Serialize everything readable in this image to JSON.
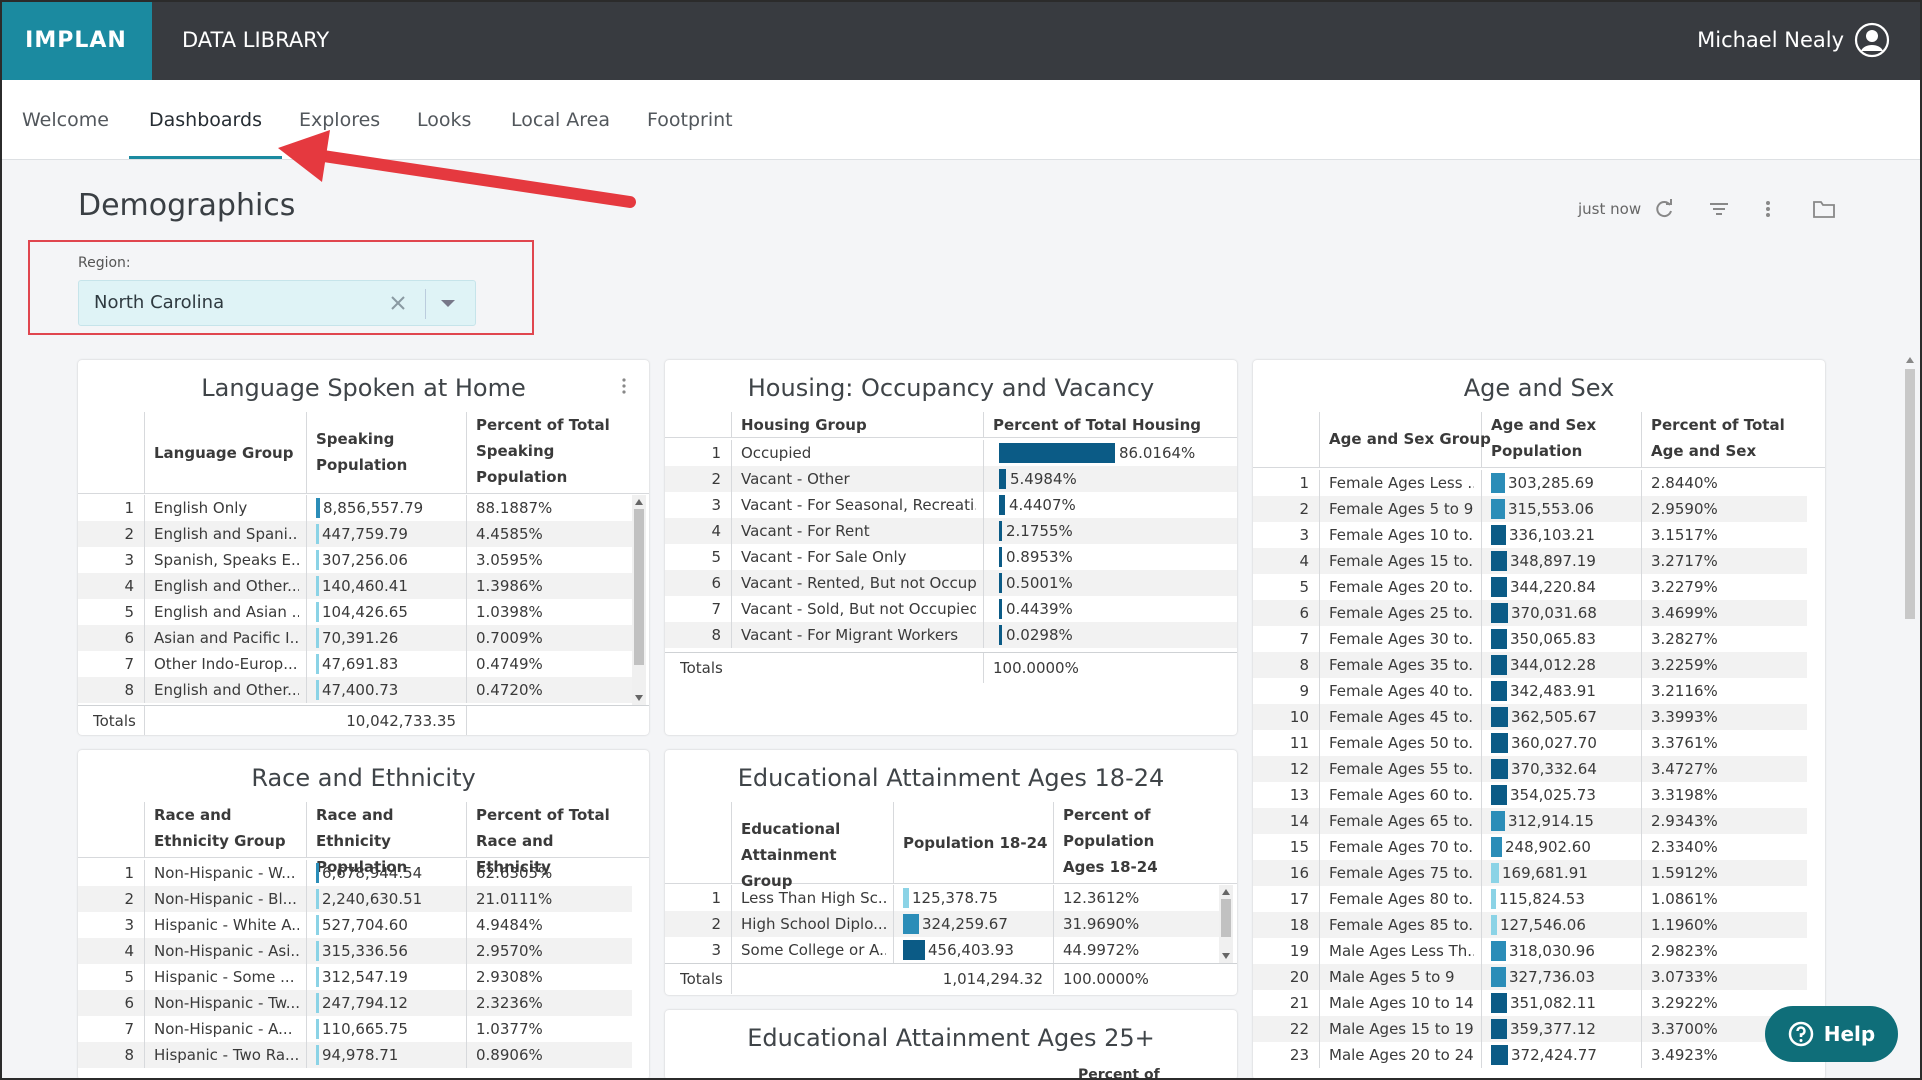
{
  "topbar": {
    "logo": "IMPLAN",
    "app_title": "DATA LIBRARY",
    "user_name": "Michael Nealy"
  },
  "nav": {
    "tabs": [
      "Welcome",
      "Dashboards",
      "Explores",
      "Looks",
      "Local Area",
      "Footprint"
    ],
    "active": "Dashboards"
  },
  "dashboard": {
    "title": "Demographics",
    "last_updated": "just now",
    "filter": {
      "label": "Region:",
      "value": "North Carolina"
    }
  },
  "colors": {
    "accent": "#1b8aa0",
    "bar_dark": "#0b5b86",
    "bar_mid": "#2b8db8",
    "bar_light": "#8bd3e6",
    "highlight": "#e0464f",
    "help": "#0f6e79"
  },
  "language": {
    "title": "Language Spoken at Home",
    "columns": [
      "Language Group",
      "Speaking Population",
      "Percent of Total Speaking Population"
    ],
    "rows": [
      {
        "n": "1",
        "group": "English Only",
        "pop": "8,856,557.79",
        "pct": "88.1887%",
        "share": 0.8819
      },
      {
        "n": "2",
        "group": "English and Spani...",
        "pop": "447,759.79",
        "pct": "4.4585%",
        "share": 0.0446
      },
      {
        "n": "3",
        "group": "Spanish, Speaks E...",
        "pop": "307,256.06",
        "pct": "3.0595%",
        "share": 0.0306
      },
      {
        "n": "4",
        "group": "English and Other...",
        "pop": "140,460.41",
        "pct": "1.3986%",
        "share": 0.014
      },
      {
        "n": "5",
        "group": "English and Asian ...",
        "pop": "104,426.65",
        "pct": "1.0398%",
        "share": 0.0104
      },
      {
        "n": "6",
        "group": "Asian and Pacific I...",
        "pop": "70,391.26",
        "pct": "0.7009%",
        "share": 0.007
      },
      {
        "n": "7",
        "group": "Other Indo-Europ...",
        "pop": "47,691.83",
        "pct": "0.4749%",
        "share": 0.0047
      },
      {
        "n": "8",
        "group": "English and Other...",
        "pop": "47,400.73",
        "pct": "0.4720%",
        "share": 0.0047
      }
    ],
    "totals": {
      "label": "Totals",
      "pop": "10,042,733.35"
    }
  },
  "housing": {
    "title": "Housing: Occupancy and Vacancy",
    "columns": [
      "Housing Group",
      "Percent of Total Housing"
    ],
    "rows": [
      {
        "n": "1",
        "group": "Occupied",
        "pct": "86.0164%",
        "share": 0.8602
      },
      {
        "n": "2",
        "group": "Vacant - Other",
        "pct": "5.4984%",
        "share": 0.055
      },
      {
        "n": "3",
        "group": "Vacant - For Seasonal, Recreati...",
        "pct": "4.4407%",
        "share": 0.0444
      },
      {
        "n": "4",
        "group": "Vacant - For Rent",
        "pct": "2.1755%",
        "share": 0.0218
      },
      {
        "n": "5",
        "group": "Vacant - For Sale Only",
        "pct": "0.8953%",
        "share": 0.009
      },
      {
        "n": "6",
        "group": "Vacant - Rented, But not Occup...",
        "pct": "0.5001%",
        "share": 0.005
      },
      {
        "n": "7",
        "group": "Vacant - Sold, But not Occupied",
        "pct": "0.4439%",
        "share": 0.0044
      },
      {
        "n": "8",
        "group": "Vacant - For Migrant Workers",
        "pct": "0.0298%",
        "share": 0.0003
      }
    ],
    "totals": {
      "label": "Totals",
      "pct": "100.0000%"
    }
  },
  "agesex": {
    "title": "Age and Sex",
    "columns": [
      "Age and Sex Group",
      "Age and Sex Population",
      "Percent of Total Age and Sex"
    ],
    "rows": [
      {
        "n": "1",
        "group": "Female Ages Less ...",
        "pop": "303,285.69",
        "pct": "2.8440%",
        "share": 0.8191
      },
      {
        "n": "2",
        "group": "Female Ages 5 to 9",
        "pop": "315,553.06",
        "pct": "2.9590%",
        "share": 0.8522
      },
      {
        "n": "3",
        "group": "Female Ages 10 to...",
        "pop": "336,103.21",
        "pct": "3.1517%",
        "share": 0.9077
      },
      {
        "n": "4",
        "group": "Female Ages 15 to...",
        "pop": "348,897.19",
        "pct": "3.2717%",
        "share": 0.9422
      },
      {
        "n": "5",
        "group": "Female Ages 20 to...",
        "pop": "344,220.84",
        "pct": "3.2279%",
        "share": 0.9296
      },
      {
        "n": "6",
        "group": "Female Ages 25 to...",
        "pop": "370,031.68",
        "pct": "3.4699%",
        "share": 0.9993
      },
      {
        "n": "7",
        "group": "Female Ages 30 to...",
        "pop": "350,065.83",
        "pct": "3.2827%",
        "share": 0.9454
      },
      {
        "n": "8",
        "group": "Female Ages 35 to...",
        "pop": "344,012.28",
        "pct": "3.2259%",
        "share": 0.9291
      },
      {
        "n": "9",
        "group": "Female Ages 40 to...",
        "pop": "342,483.91",
        "pct": "3.2116%",
        "share": 0.9249
      },
      {
        "n": "10",
        "group": "Female Ages 45 to...",
        "pop": "362,505.67",
        "pct": "3.3993%",
        "share": 0.979
      },
      {
        "n": "11",
        "group": "Female Ages 50 to...",
        "pop": "360,027.70",
        "pct": "3.3761%",
        "share": 0.9723
      },
      {
        "n": "12",
        "group": "Female Ages 55 to...",
        "pop": "370,332.64",
        "pct": "3.4727%",
        "share": 1.0
      },
      {
        "n": "13",
        "group": "Female Ages 60 to...",
        "pop": "354,025.73",
        "pct": "3.3198%",
        "share": 0.956
      },
      {
        "n": "14",
        "group": "Female Ages 65 to...",
        "pop": "312,914.15",
        "pct": "2.9343%",
        "share": 0.845
      },
      {
        "n": "15",
        "group": "Female Ages 70 to...",
        "pop": "248,902.60",
        "pct": "2.3340%",
        "share": 0.6721
      },
      {
        "n": "16",
        "group": "Female Ages 75 to...",
        "pop": "169,681.91",
        "pct": "1.5912%",
        "share": 0.4582
      },
      {
        "n": "17",
        "group": "Female Ages 80 to...",
        "pop": "115,824.53",
        "pct": "1.0861%",
        "share": 0.3128
      },
      {
        "n": "18",
        "group": "Female Ages 85 to...",
        "pop": "127,546.06",
        "pct": "1.1960%",
        "share": 0.3444
      },
      {
        "n": "19",
        "group": "Male Ages Less Th...",
        "pop": "318,030.96",
        "pct": "2.9823%",
        "share": 0.8588
      },
      {
        "n": "20",
        "group": "Male Ages 5 to 9",
        "pop": "327,736.03",
        "pct": "3.0733%",
        "share": 0.885
      },
      {
        "n": "21",
        "group": "Male Ages 10 to 14",
        "pop": "351,082.11",
        "pct": "3.2922%",
        "share": 0.948
      },
      {
        "n": "22",
        "group": "Male Ages 15 to 19",
        "pop": "359,377.12",
        "pct": "3.3700%",
        "share": 0.9704
      },
      {
        "n": "23",
        "group": "Male Ages 20 to 24",
        "pop": "372,424.77",
        "pct": "3.4923%",
        "share": 1.0
      }
    ]
  },
  "race": {
    "title": "Race and Ethnicity",
    "columns": [
      "Race and Ethnicity Group",
      "Race and Ethnicity Population",
      "Percent of Total Race and Ethnicity"
    ],
    "rows": [
      {
        "n": "1",
        "group": "Non-Hispanic - W...",
        "pop": "6,678,944.54",
        "pct": "62.6305%",
        "share": 0.6263
      },
      {
        "n": "2",
        "group": "Non-Hispanic - Bl...",
        "pop": "2,240,630.51",
        "pct": "21.0111%",
        "share": 0.2101
      },
      {
        "n": "3",
        "group": "Hispanic - White A...",
        "pop": "527,704.60",
        "pct": "4.9484%",
        "share": 0.0495
      },
      {
        "n": "4",
        "group": "Non-Hispanic - Asi...",
        "pop": "315,336.56",
        "pct": "2.9570%",
        "share": 0.0296
      },
      {
        "n": "5",
        "group": "Hispanic - Some ...",
        "pop": "312,547.19",
        "pct": "2.9308%",
        "share": 0.0293
      },
      {
        "n": "6",
        "group": "Non-Hispanic - Tw...",
        "pop": "247,794.12",
        "pct": "2.3236%",
        "share": 0.0232
      },
      {
        "n": "7",
        "group": "Non-Hispanic - A...",
        "pop": "110,665.75",
        "pct": "1.0377%",
        "share": 0.0104
      },
      {
        "n": "8",
        "group": "Hispanic - Two Ra...",
        "pop": "94,978.71",
        "pct": "0.8906%",
        "share": 0.0089
      }
    ]
  },
  "edu1824": {
    "title": "Educational Attainment Ages 18-24",
    "columns": [
      "Educational Attainment Group",
      "Population 18-24",
      "Percent of Population Ages 18-24"
    ],
    "rows": [
      {
        "n": "1",
        "group": "Less Than High Sc...",
        "pop": "125,378.75",
        "pct": "12.3612%",
        "share": 0.2747
      },
      {
        "n": "2",
        "group": "High School Diplo...",
        "pop": "324,259.67",
        "pct": "31.9690%",
        "share": 0.7104
      },
      {
        "n": "3",
        "group": "Some College or A...",
        "pop": "456,403.93",
        "pct": "44.9972%",
        "share": 1.0
      }
    ],
    "totals": {
      "label": "Totals",
      "pop": "1,014,294.32",
      "pct": "100.0000%"
    }
  },
  "edu25": {
    "title": "Educational Attainment Ages 25+",
    "partial_header": "Percent of"
  },
  "help": {
    "label": "Help",
    "icon": "question-circle-icon"
  }
}
